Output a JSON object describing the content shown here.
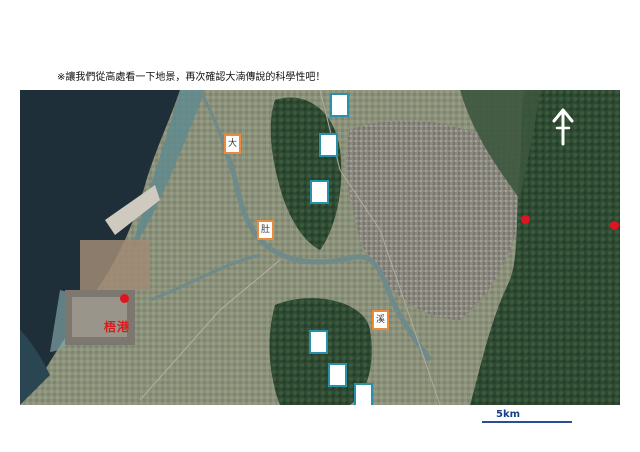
{
  "caption": "※讓我們從高處看一下地景，再次確認大湳傳說的科學性吧！",
  "labels": {
    "box_da": "大",
    "box_du": "肚",
    "box_xi": "溪",
    "port": "梧港"
  },
  "scale": {
    "text": "5km"
  },
  "icons": {
    "north": "north-arrow-icon",
    "marker": "red-dot-icon"
  },
  "colors": {
    "orange_box_border": "#e98a3c",
    "blue_box_border": "#2a8fa8",
    "marker": "#e0141e",
    "port_label": "#d41c1c",
    "scale": "#2c4e9a"
  }
}
